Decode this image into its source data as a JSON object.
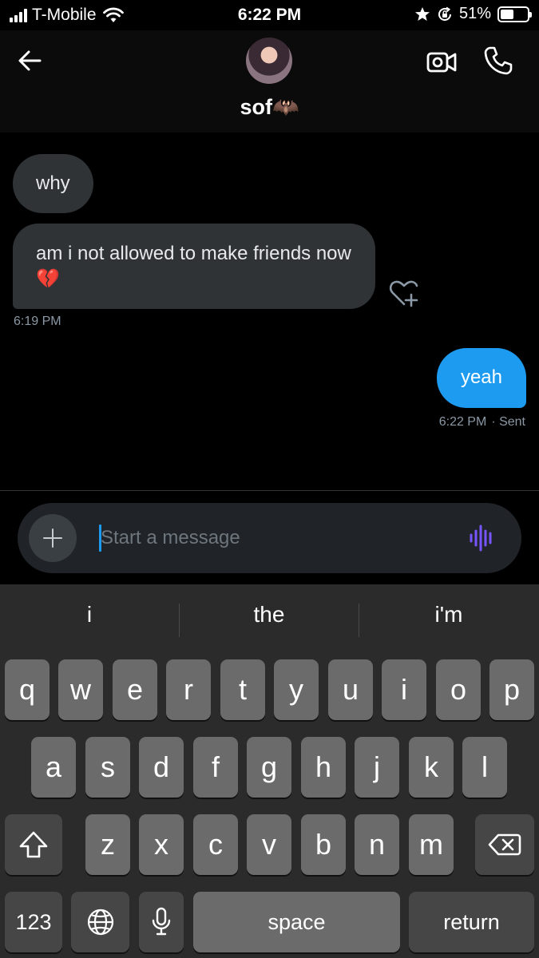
{
  "status_bar": {
    "carrier": "T-Mobile",
    "time": "6:22 PM",
    "battery": "51%",
    "battery_level": 0.51,
    "icons": [
      "signal-icon",
      "wifi-icon",
      "star-icon",
      "orientation-lock-icon",
      "battery-icon"
    ]
  },
  "header": {
    "contact_name": "sof",
    "contact_emoji": "🦇",
    "icons": [
      "back-arrow-icon",
      "video-call-icon",
      "phone-icon"
    ]
  },
  "messages": [
    {
      "direction": "incoming",
      "text": "why"
    },
    {
      "direction": "incoming",
      "text": "am i not allowed to make friends now 💔"
    },
    {
      "direction": "outgoing",
      "text": "yeah"
    }
  ],
  "timestamps": {
    "incoming": "6:19 PM",
    "outgoing_time": "6:22 PM",
    "outgoing_status": "· Sent"
  },
  "composer": {
    "placeholder": "Start a message",
    "icons": [
      "plus-icon",
      "voice-icon"
    ]
  },
  "keyboard": {
    "suggestions": [
      "i",
      "the",
      "i'm"
    ],
    "row1": [
      "q",
      "w",
      "e",
      "r",
      "t",
      "y",
      "u",
      "i",
      "o",
      "p"
    ],
    "row2": [
      "a",
      "s",
      "d",
      "f",
      "g",
      "h",
      "j",
      "k",
      "l"
    ],
    "row3": [
      "z",
      "x",
      "c",
      "v",
      "b",
      "n",
      "m"
    ],
    "numbers_label": "123",
    "space_label": "space",
    "return_label": "return"
  },
  "colors": {
    "accent": "#1d9bf0",
    "incoming_bubble": "#2f3336",
    "voice": "#7856ff"
  }
}
